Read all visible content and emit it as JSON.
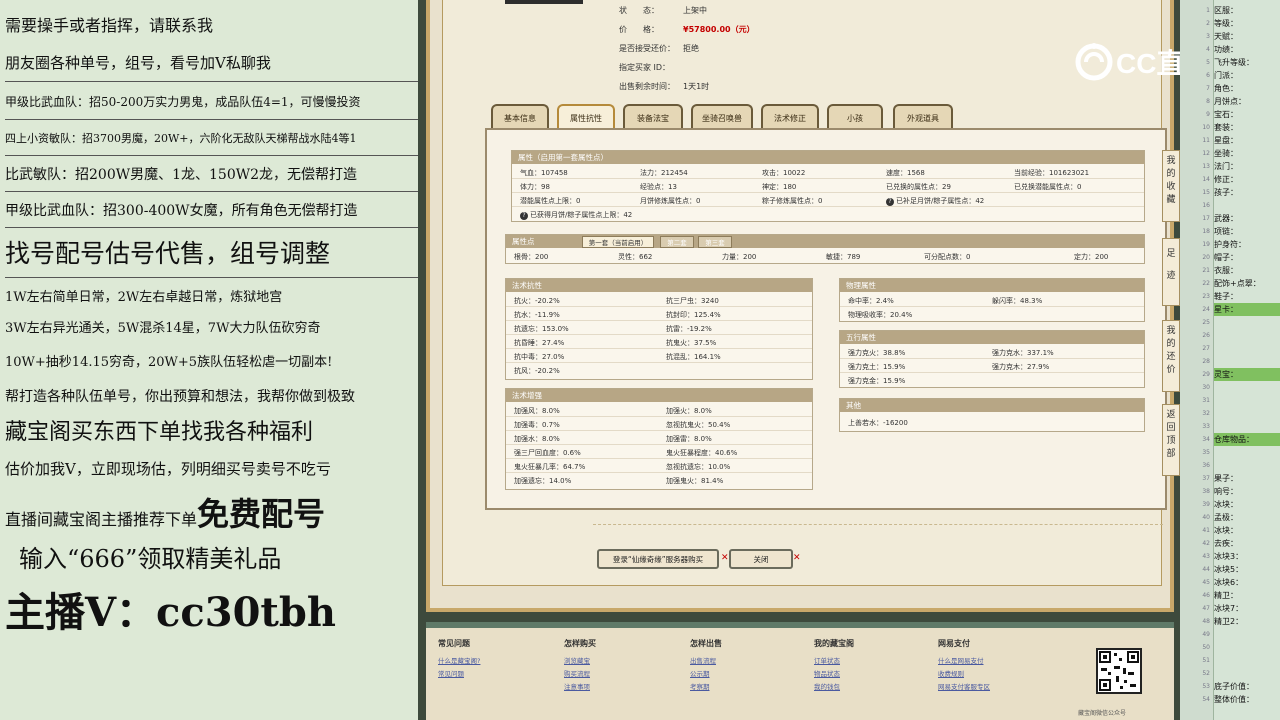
{
  "left_panel": {
    "lines": [
      "需要操手或者指挥，请联系我",
      "朋友圈各种单号，组号，看号加V私聊我",
      "甲级比武血队：招50-200万实力男鬼，成品队伍4=1，可慢慢投资",
      "四上小资敏队：招3700男魔，20W+，六阶化无敌队天梯帮战水陆4等1",
      "比武敏队：招200W男魔、1龙、150W2龙，无偿帮打造",
      "甲级比武血队：招300-400W女魔，所有角色无偿帮打造",
      "找号配号估号代售，组号调整",
      "1W左右简单日常，2W左右卓越日常，炼狱地宫",
      "3W左右异光通关，5W混杀14星，7W大力队伍砍穷奇",
      "10W+抽秒14.15穷奇，20W+5族队伍轻松虐一切副本!",
      "帮打造各种队伍单号，你出预算和想法，我帮你做到极致",
      "藏宝阁买东西下单找我各种福利",
      "估价加我V，立即现场估，列明细买号卖号不吃亏",
      "直播间藏宝阁主播推荐下单",
      "免费配号",
      "输入“666”领取精美礼品",
      "主播V：cc30tbh"
    ]
  },
  "listing": {
    "status_label": "状　　态：",
    "status_value": "上架中",
    "price_label": "价　　格：",
    "price_value": "¥57800.00（元）",
    "bargain_label": "是否接受还价：",
    "bargain_value": "拒绝",
    "buyer_label": "指定买家 ID：",
    "buyer_value": "",
    "remain_label": "出售剩余时间：",
    "remain_value": "1天1时"
  },
  "tabs": [
    "基本信息",
    "属性抗性",
    "装备法宝",
    "坐骑召唤兽",
    "法术修正",
    "小孩",
    "外观道具"
  ],
  "attr_title": "属性（启用第一套属性点）",
  "attrs": [
    [
      "气血：107458",
      "法力：212454",
      "攻击：10022",
      "速度：1568",
      "当前经验：101623021"
    ],
    [
      "体力：98",
      "经验点：13",
      "神定：180",
      "已兑换的属性点：29",
      "已兑换潜能属性点：0"
    ],
    [
      "潜能属性点上限：0",
      "月饼修炼属性点：0",
      "粽子修炼属性点：0",
      "已补足月饼/粽子属性点：42",
      ""
    ],
    [
      "已获得月饼/粽子属性点上限：42",
      "",
      "",
      "",
      ""
    ]
  ],
  "points": {
    "title": "属性点",
    "subtabs": [
      "第一套（当前启用）",
      "第二套",
      "第三套"
    ],
    "values": [
      "根骨：200",
      "灵性：662",
      "力量：200",
      "敏捷：789",
      "可分配点数：0",
      "定力：200"
    ]
  },
  "resist": {
    "title": "法术抗性",
    "rows": [
      [
        "抗火：-20.2%",
        "抗三尸虫：3240"
      ],
      [
        "抗水：-11.9%",
        "抗封印：125.4%"
      ],
      [
        "抗遗忘：153.0%",
        "抗雷：-19.2%"
      ],
      [
        "抗昏睡：27.4%",
        "抗鬼火：37.5%"
      ],
      [
        "抗中毒：27.0%",
        "抗混乱：164.1%"
      ],
      [
        "抗风：-20.2%",
        ""
      ]
    ]
  },
  "boost": {
    "title": "法术增强",
    "rows": [
      [
        "加强风：8.0%",
        "加强火：8.0%"
      ],
      [
        "加强毒：0.7%",
        "忽视抗鬼火：50.4%"
      ],
      [
        "加强水：8.0%",
        "加强雷：8.0%"
      ],
      [
        "强三尸回血度：0.6%",
        "鬼火狂暴程度：40.6%"
      ],
      [
        "鬼火狂暴几率：64.7%",
        "忽视抗遗忘：10.0%"
      ],
      [
        "加强遗忘：14.0%",
        "加强鬼火：81.4%"
      ]
    ]
  },
  "physical": {
    "title": "物理属性",
    "rows": [
      [
        "命中率：2.4%",
        "躲闪率：48.3%"
      ],
      [
        "物理吸收率：20.4%",
        ""
      ]
    ]
  },
  "elements": {
    "title": "五行属性",
    "rows": [
      [
        "强力克火：38.8%",
        "强力克水：337.1%"
      ],
      [
        "强力克土：15.9%",
        "强力克木：27.9%"
      ],
      [
        "强力克金：15.9%",
        ""
      ]
    ]
  },
  "other": {
    "title": "其他",
    "rows": [
      [
        "上善若水：-16200"
      ]
    ]
  },
  "buttons": {
    "login": "登录“仙缘奇缘”服务器购买",
    "close": "关闭"
  },
  "side_tabs": [
    "我的收藏",
    "足迹",
    "我的还价",
    "返回顶部"
  ],
  "footer": {
    "cols": [
      {
        "title": "常见问题",
        "links": [
          "什么是藏宝阁?",
          "常见问题"
        ]
      },
      {
        "title": "怎样购买",
        "links": [
          "浏览藏宝",
          "购买流程",
          "注意事项"
        ]
      },
      {
        "title": "怎样出售",
        "links": [
          "出售流程",
          "公示期",
          "考察期"
        ]
      },
      {
        "title": "我的藏宝阁",
        "links": [
          "订单状态",
          "物品状态",
          "我的钱包"
        ]
      },
      {
        "title": "网易支付",
        "links": [
          "什么是网易支付",
          "收费规则",
          "网易支付客服专区"
        ]
      }
    ],
    "qr_caption": "藏宝阁微信公众号"
  },
  "logo_text": "CC直播",
  "right_panel": {
    "rows": [
      "区服：",
      "等级：",
      "天赋：",
      "功绩：",
      "飞升等级：",
      "门派：",
      "角色：",
      "月饼点：",
      "宝石：",
      "套装：",
      "星盘：",
      "坐骑：",
      "法门：",
      "修正：",
      "孩子：",
      "",
      "武器：",
      "项链：",
      "护身符：",
      "帽子：",
      "衣服：",
      "配饰+点翠：",
      "鞋子：",
      "星卡：",
      "",
      "",
      "",
      "",
      "灵宝：",
      "",
      "",
      "",
      "",
      "仓库物品：",
      "",
      "",
      "果子：",
      "响号：",
      "冰块：",
      "孟极：",
      "冰块：",
      "去疾：",
      "冰块3：",
      "冰块5：",
      "冰块6：",
      "精卫：",
      "冰块7：",
      "精卫2：",
      "",
      "",
      "",
      "",
      "底子价值：",
      "整体价值："
    ]
  }
}
